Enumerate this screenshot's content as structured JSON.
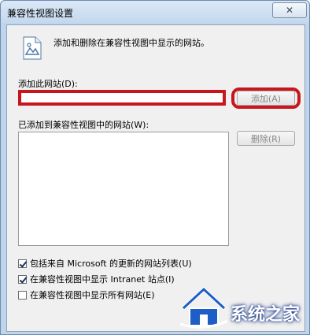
{
  "window": {
    "title": "兼容性视图设置",
    "close_symbol": "✕"
  },
  "description": "添加和删除在兼容性视图中显示的网站。",
  "add_site": {
    "label": "添加此网站(D):",
    "value": "",
    "button_label": "添加(A)"
  },
  "added_sites": {
    "label": "已添加到兼容性视图中的网站(W):",
    "items": [],
    "remove_button_label": "删除(R)"
  },
  "options": [
    {
      "label": "包括来自 Microsoft 的更新的网站列表(U)",
      "checked": true
    },
    {
      "label": "在兼容性视图中显示 Intranet 站点(I)",
      "checked": true
    },
    {
      "label": "在兼容性视图中显示所有网站(E)",
      "checked": false
    }
  ],
  "watermark": {
    "text": "系统之家"
  },
  "colors": {
    "highlight": "#c8161d"
  }
}
